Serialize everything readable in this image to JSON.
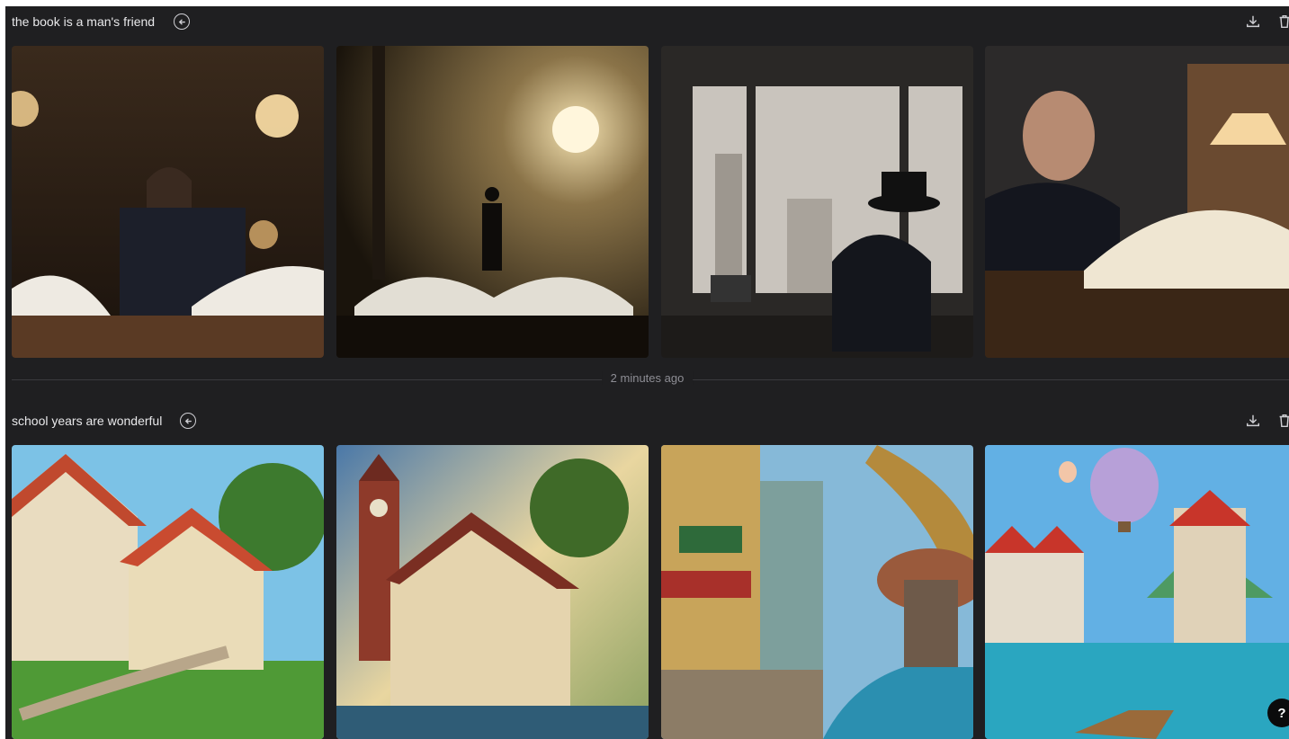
{
  "groups": [
    {
      "prompt": "the book is a man's friend",
      "images": [
        {
          "icon": "man-reading-book-at-desk"
        },
        {
          "icon": "man-standing-on-open-book"
        },
        {
          "icon": "man-in-hat-at-window"
        },
        {
          "icon": "man-portrait-with-open-book"
        }
      ]
    },
    {
      "prompt": "school years are wonderful",
      "images": [
        {
          "icon": "tudor-village-scene"
        },
        {
          "icon": "clock-tower-village-scene"
        },
        {
          "icon": "city-street-with-canal"
        },
        {
          "icon": "balloon-castle-river-scene"
        }
      ]
    }
  ],
  "timestamp_divider": "2 minutes ago",
  "help_label": "?",
  "icons": {
    "reuse": "arrow-left-circle-icon",
    "download": "download-icon",
    "delete": "trash-icon"
  },
  "colors": {
    "background": "#1f1f21",
    "text": "#e8e8ea",
    "muted": "#8d8d94"
  }
}
